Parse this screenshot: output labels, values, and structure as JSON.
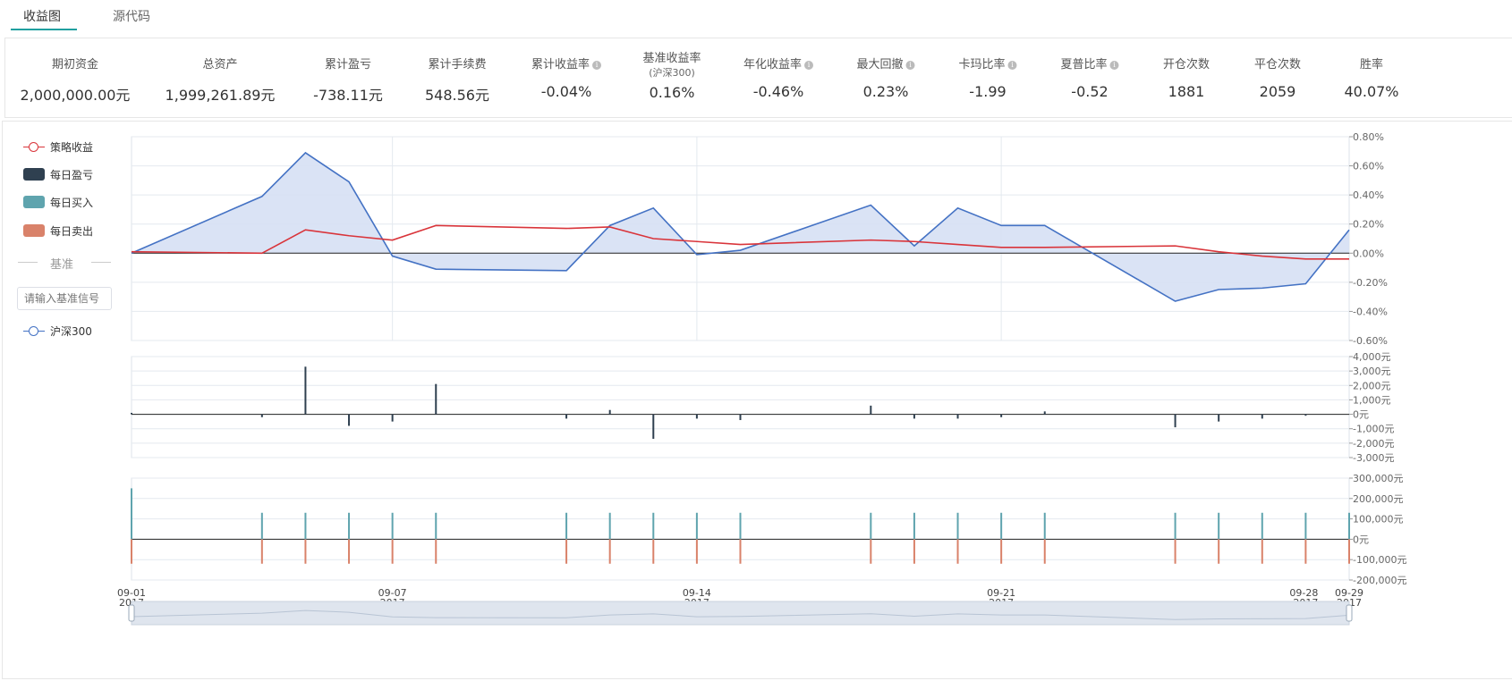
{
  "tabs": [
    {
      "label": "收益图",
      "active": true
    },
    {
      "label": "源代码",
      "active": false
    }
  ],
  "metrics": [
    {
      "label": "期初资金",
      "value": "2,000,000.00元"
    },
    {
      "label": "总资产",
      "value": "1,999,261.89元"
    },
    {
      "label": "累计盈亏",
      "value": "-738.11元"
    },
    {
      "label": "累计手续费",
      "value": "548.56元"
    },
    {
      "label": "累计收益率",
      "value": "-0.04%",
      "info": true
    },
    {
      "label": "基准收益率",
      "sublabel": "(沪深300)",
      "value": "0.16%"
    },
    {
      "label": "年化收益率",
      "value": "-0.46%",
      "info": true
    },
    {
      "label": "最大回撤",
      "value": "0.23%",
      "info": true
    },
    {
      "label": "卡玛比率",
      "value": "-1.99",
      "info": true
    },
    {
      "label": "夏普比率",
      "value": "-0.52",
      "info": true
    },
    {
      "label": "开仓次数",
      "value": "1881"
    },
    {
      "label": "平仓次数",
      "value": "2059"
    },
    {
      "label": "胜率",
      "value": "40.07%"
    }
  ],
  "legend": {
    "strategy": "策略收益",
    "daily_pnl": "每日盈亏",
    "daily_buy": "每日买入",
    "daily_sell": "每日卖出",
    "benchmark_heading": "基准",
    "benchmark_placeholder": "请输入基准信号",
    "benchmark_series": "沪深300"
  },
  "colors": {
    "accent": "#20a0a0",
    "strategy": "#d9343a",
    "benchmark": "#4472c4",
    "benchmark_fill": "#d6e0f4",
    "pnl": "#2f4050",
    "buy": "#5fa4ae",
    "sell": "#d9826a",
    "grid": "#e4e9ef"
  },
  "chart_data": [
    {
      "type": "line",
      "name": "returns",
      "x": [
        "09-01",
        "09-04",
        "09-05",
        "09-06",
        "09-07",
        "09-08",
        "09-11",
        "09-12",
        "09-13",
        "09-14",
        "09-15",
        "09-18",
        "09-19",
        "09-20",
        "09-21",
        "09-22",
        "09-25",
        "09-26",
        "09-27",
        "09-28",
        "09-29"
      ],
      "series": [
        {
          "name": "策略收益",
          "values": [
            0.01,
            0.0,
            0.16,
            0.12,
            0.09,
            0.19,
            0.17,
            0.18,
            0.1,
            0.08,
            0.06,
            0.09,
            0.08,
            0.06,
            0.04,
            0.04,
            0.05,
            0.01,
            -0.02,
            -0.04,
            -0.04
          ]
        },
        {
          "name": "沪深300",
          "values": [
            0.0,
            0.39,
            0.69,
            0.49,
            -0.02,
            -0.11,
            -0.12,
            0.19,
            0.31,
            -0.01,
            0.02,
            0.33,
            0.05,
            0.31,
            0.19,
            0.19,
            -0.33,
            -0.25,
            -0.24,
            -0.21,
            0.16
          ]
        }
      ],
      "yticks": [
        "0.80%",
        "0.60%",
        "0.40%",
        "0.20%",
        "0.00%",
        "-0.20%",
        "-0.40%",
        "-0.60%"
      ],
      "ylim": [
        -0.6,
        0.8
      ]
    },
    {
      "type": "bar",
      "name": "daily_pnl",
      "series": [
        {
          "name": "每日盈亏",
          "values": [
            100,
            -200,
            3300,
            -800,
            -500,
            2100,
            -300,
            300,
            -1700,
            -300,
            -400,
            600,
            -300,
            -300,
            -200,
            200,
            -900,
            -500,
            -300,
            -100
          ]
        }
      ],
      "yticks": [
        "4,000元",
        "3,000元",
        "2,000元",
        "1,000元",
        "0元",
        "-1,000元",
        "-2,000元",
        "-3,000元"
      ],
      "ylim": [
        -3000,
        4000
      ]
    },
    {
      "type": "bar",
      "name": "buy_sell",
      "series": [
        {
          "name": "每日买入",
          "values": [
            250000,
            130000,
            130000,
            130000,
            130000,
            130000,
            130000,
            130000,
            130000,
            130000,
            130000,
            130000,
            130000,
            130000,
            130000,
            130000,
            130000,
            130000,
            130000,
            130000,
            130000
          ]
        },
        {
          "name": "每日卖出",
          "values": [
            -120000,
            -120000,
            -120000,
            -120000,
            -120000,
            -120000,
            -120000,
            -120000,
            -120000,
            -120000,
            -120000,
            -120000,
            -120000,
            -120000,
            -120000,
            -120000,
            -120000,
            -120000,
            -120000,
            -120000,
            -120000
          ]
        }
      ],
      "yticks": [
        "300,000元",
        "200,000元",
        "100,000元",
        "0元",
        "-100,000元",
        "-200,000元"
      ],
      "ylim": [
        -200000,
        300000
      ]
    }
  ],
  "xaxis": {
    "labels": [
      {
        "date": "09-01",
        "year": "2017"
      },
      {
        "date": "09-07",
        "year": "2017"
      },
      {
        "date": "09-14",
        "year": "2017"
      },
      {
        "date": "09-21",
        "year": "2017"
      },
      {
        "date": "09-28",
        "year": "2017"
      },
      {
        "date": "09-29",
        "year": "2017"
      }
    ]
  }
}
